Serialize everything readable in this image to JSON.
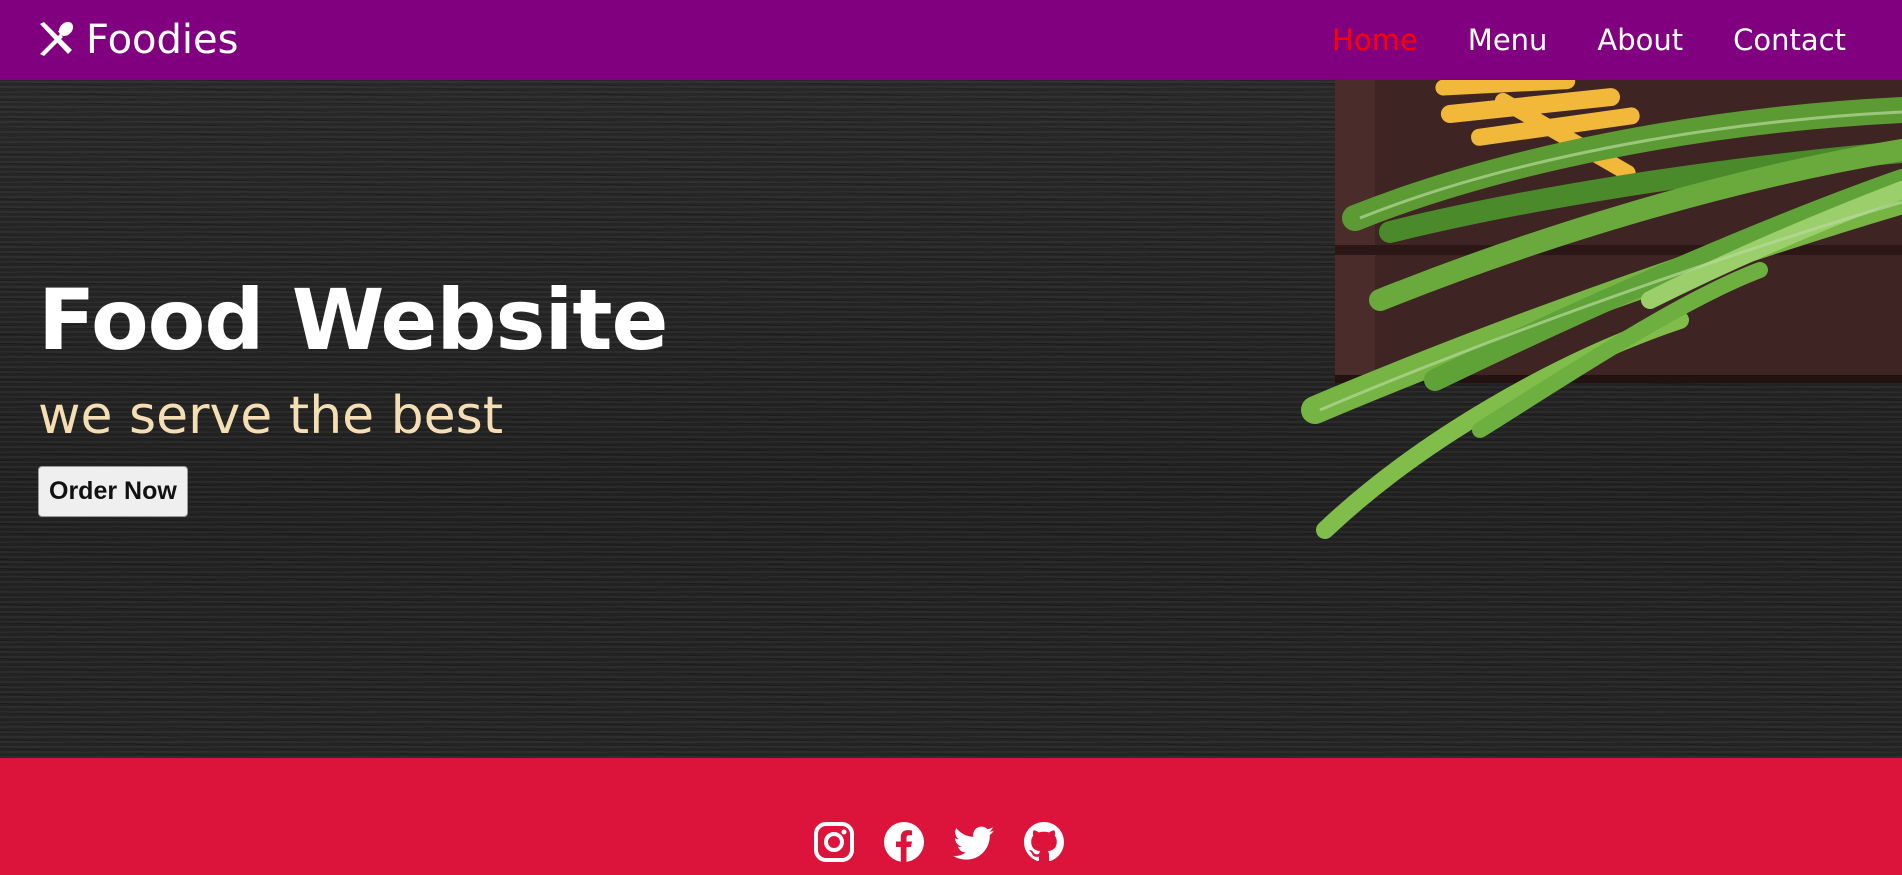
{
  "navbar": {
    "brand_icon": "fork-spoon-icon",
    "brand_name": "Foodies",
    "links": [
      {
        "label": "Home",
        "active": true
      },
      {
        "label": "Menu",
        "active": false
      },
      {
        "label": "About",
        "active": false
      },
      {
        "label": "Contact",
        "active": false
      }
    ],
    "active_color": "#ff0000"
  },
  "hero": {
    "title": "Food Website",
    "subtitle": "we serve the best",
    "button_label": "Order Now",
    "background_image": "dark wood table with green onions and baby corn"
  },
  "footer": {
    "social_icons": [
      "instagram-icon",
      "facebook-icon",
      "twitter-icon",
      "github-icon"
    ]
  },
  "colors": {
    "navbar": "#800080",
    "footer": "#dc143c",
    "subtitle": "#f5deb3",
    "text": "#ffffff"
  }
}
